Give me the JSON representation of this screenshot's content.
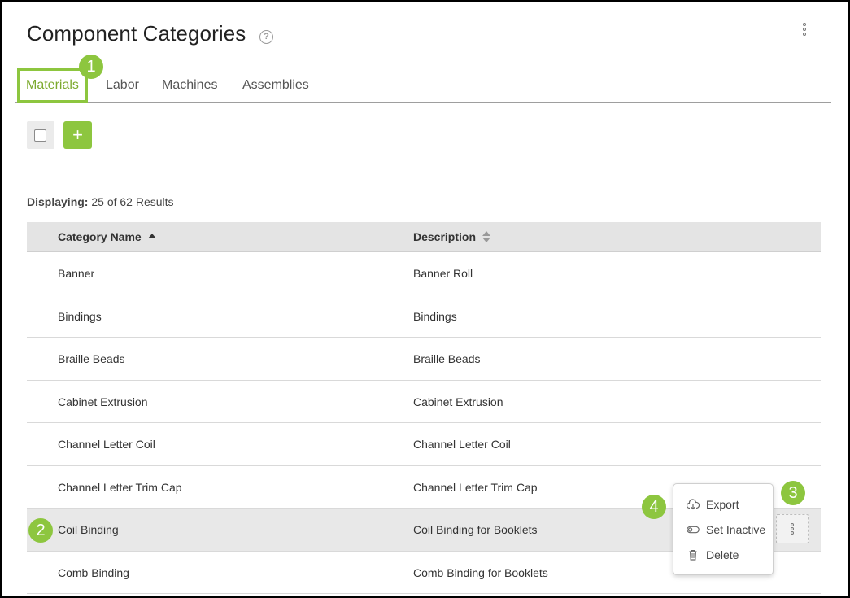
{
  "page": {
    "title": "Component Categories"
  },
  "tabs": [
    {
      "label": "Materials"
    },
    {
      "label": "Labor"
    },
    {
      "label": "Machines"
    },
    {
      "label": "Assemblies"
    }
  ],
  "toolbar": {
    "add_label": "+"
  },
  "results": {
    "prefix": "Displaying:",
    "text": "25 of 62 Results"
  },
  "table": {
    "columns": [
      {
        "label": "Category Name"
      },
      {
        "label": "Description"
      }
    ],
    "rows": [
      {
        "name": "Banner",
        "description": "Banner Roll"
      },
      {
        "name": "Bindings",
        "description": "Bindings"
      },
      {
        "name": "Braille Beads",
        "description": "Braille Beads"
      },
      {
        "name": "Cabinet Extrusion",
        "description": "Cabinet Extrusion"
      },
      {
        "name": "Channel Letter Coil",
        "description": "Channel Letter Coil"
      },
      {
        "name": "Channel Letter Trim Cap",
        "description": "Channel Letter Trim Cap"
      },
      {
        "name": "Coil Binding",
        "description": "Coil Binding for Booklets"
      },
      {
        "name": "Comb Binding",
        "description": "Comb Binding for Booklets"
      }
    ]
  },
  "context_menu": {
    "items": [
      {
        "label": "Export",
        "icon": "cloud-download-icon"
      },
      {
        "label": "Set Inactive",
        "icon": "toggle-icon"
      },
      {
        "label": "Delete",
        "icon": "trash-icon"
      }
    ]
  },
  "badges": [
    "1",
    "2",
    "3",
    "4"
  ],
  "colors": {
    "accent": "#8dc63f",
    "accent_text": "#7daa2f",
    "header_bg": "#e4e4e4",
    "highlight_row": "#e8e8e8"
  }
}
